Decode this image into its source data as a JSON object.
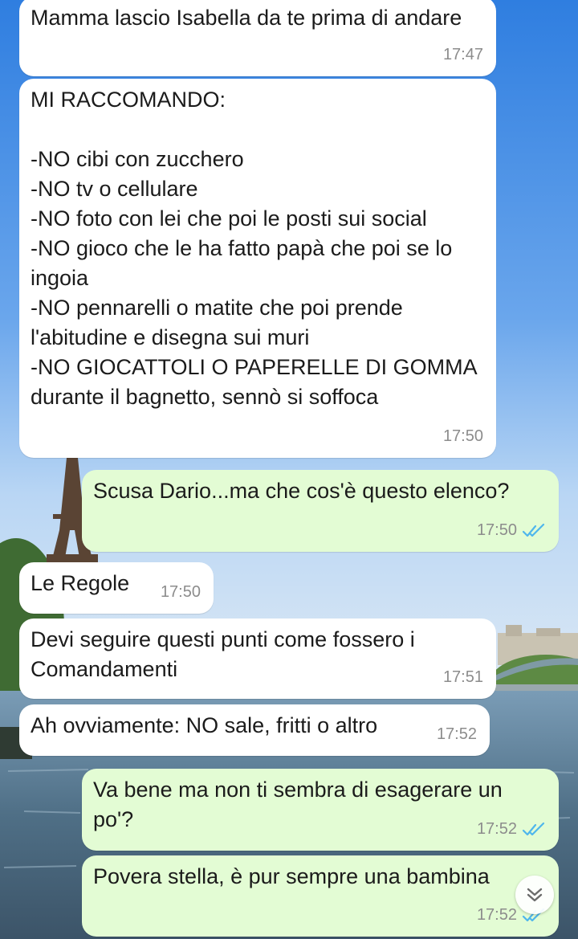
{
  "colors": {
    "incoming_bubble": "#ffffff",
    "outgoing_bubble": "#e3fcd4",
    "timestamp": "#8c8c8c",
    "read_receipt": "#4fb6ec"
  },
  "icons": {
    "read_receipt": "double-check-icon",
    "scroll_down": "chevron-double-down-icon"
  },
  "messages": [
    {
      "direction": "in",
      "text": "Mamma lascio Isabella da te prima di andare",
      "time": "17:47"
    },
    {
      "direction": "in",
      "text": "MI RACCOMANDO:\n\n-NO cibi con zucchero\n-NO tv o cellulare\n-NO foto con lei che poi le posti sui social\n-NO gioco che le ha fatto papà che poi se lo ingoia\n-NO pennarelli o matite che poi prende l'abitudine e disegna sui muri\n-NO GIOCATTOLI O PAPERELLE DI GOMMA durante il bagnetto, sennò si soffoca",
      "time": "17:50"
    },
    {
      "direction": "out",
      "text": "Scusa Dario...ma che cos'è questo elenco?",
      "time": "17:50",
      "read": true
    },
    {
      "direction": "in",
      "text": "Le Regole",
      "time": "17:50"
    },
    {
      "direction": "in",
      "text": "Devi seguire questi punti come fossero i Comandamenti",
      "time": "17:51"
    },
    {
      "direction": "in",
      "text": "Ah ovviamente: NO sale, fritti o altro",
      "time": "17:52"
    },
    {
      "direction": "out",
      "text": "Va bene ma non ti sembra di esagerare un po'?",
      "time": "17:52",
      "read": true
    },
    {
      "direction": "out",
      "text": "Povera stella, è pur sempre una bambina",
      "time": "17:52",
      "read": true
    }
  ]
}
